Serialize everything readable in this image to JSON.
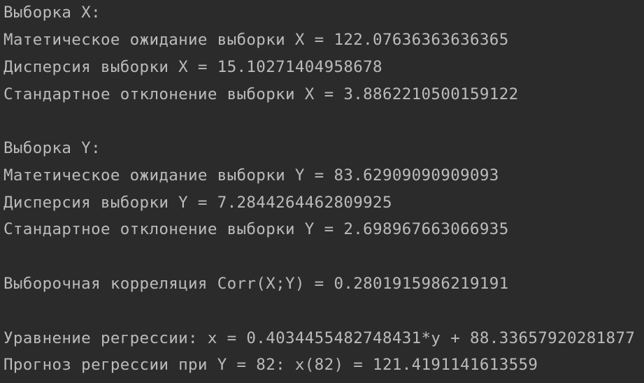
{
  "console": {
    "sample_x": {
      "heading": "Выборка X:",
      "mean": "Матетическое ожидание выборки X = 122.07636363636365",
      "variance": "Дисперсия выборки X = 15.10271404958678",
      "stddev": "Стандартное отклонение выборки X = 3.8862210500159122"
    },
    "sample_y": {
      "heading": "Выборка Y:",
      "mean": "Матетическое ожидание выборки Y = 83.62909090909093",
      "variance": "Дисперсия выборки Y = 7.2844264462809925",
      "stddev": "Стандартное отклонение выборки Y = 2.698967663066935"
    },
    "correlation": "Выборочная корреляция Corr(X;Y) = 0.2801915986219191",
    "regression_equation": "Уравнение регрессии: x = 0.4034455482748431*y + 88.33657920281877",
    "regression_forecast": "Прогноз регрессии при Y = 82: x(82) = 121.4191141613559"
  }
}
